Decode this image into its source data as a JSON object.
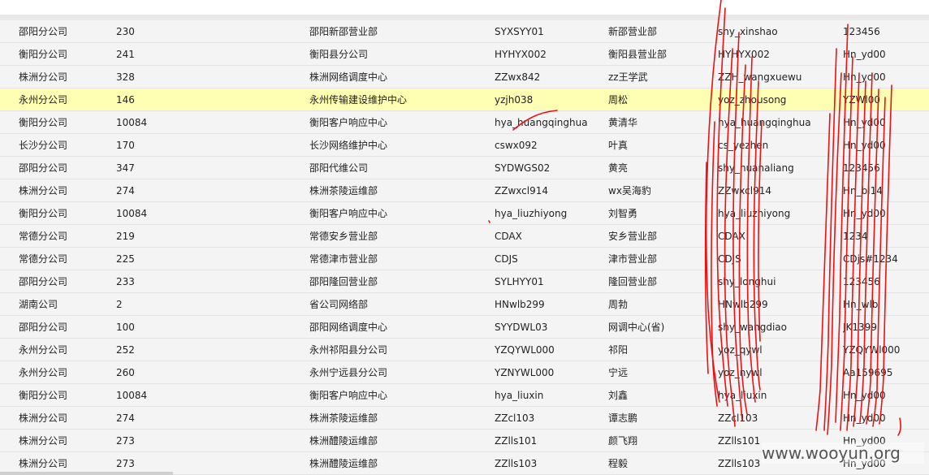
{
  "table": {
    "rows": [
      {
        "branch": "邵阳分公司",
        "code": "230",
        "department": "邵阳新邵营业部",
        "account": "SYXSYY01",
        "name": "新邵营业部",
        "login": "shy_xinshao",
        "password": "123456",
        "highlighted": false
      },
      {
        "branch": "衡阳分公司",
        "code": "241",
        "department": "衡阳县分公司",
        "account": "HYHYX002",
        "name": "衡阳县营业部",
        "login": "HYHYX002",
        "password": "Hn_yd00",
        "highlighted": false
      },
      {
        "branch": "株洲分公司",
        "code": "328",
        "department": "株洲网络调度中心",
        "account": "ZZwx842",
        "name": "zz王学武",
        "login": "ZZH_wangxuewu",
        "password": "Hn_yd00",
        "highlighted": false
      },
      {
        "branch": "永州分公司",
        "code": "146",
        "department": "永州传输建设维护中心",
        "account": "yzjh038",
        "name": "周松",
        "login": "yoz_zhousong",
        "password": "YZWl00",
        "highlighted": true
      },
      {
        "branch": "衡阳分公司",
        "code": "10084",
        "department": "衡阳客户响应中心",
        "account": "hya_huangqinghua",
        "name": "黄清华",
        "login": "hya_huangqinghua",
        "password": "Hn_yd00",
        "highlighted": false
      },
      {
        "branch": "长沙分公司",
        "code": "170",
        "department": "长沙网络维护中心",
        "account": "cswx092",
        "name": "叶真",
        "login": "cs_yezhen",
        "password": "Hn_yd00",
        "highlighted": false
      },
      {
        "branch": "邵阳分公司",
        "code": "347",
        "department": "邵阳代维公司",
        "account": "SYDWGS02",
        "name": "黄亮",
        "login": "shy_huanaliang",
        "password": "123456",
        "highlighted": false
      },
      {
        "branch": "株洲分公司",
        "code": "274",
        "department": "株洲茶陵运维部",
        "account": "ZZwxcl914",
        "name": "wx吴海豹",
        "login": "ZZwxcl914",
        "password": "Hn_bl14",
        "highlighted": false
      },
      {
        "branch": "衡阳分公司",
        "code": "10084",
        "department": "衡阳客户响应中心",
        "account": "hya_liuzhiyong",
        "name": "刘智勇",
        "login": "hya_liuzhiyong",
        "password": "Hn_yd00",
        "highlighted": false
      },
      {
        "branch": "常德分公司",
        "code": "219",
        "department": "常德安乡营业部",
        "account": "CDAX",
        "name": "安乡营业部",
        "login": "CDAX",
        "password": "1234",
        "highlighted": false
      },
      {
        "branch": "常德分公司",
        "code": "225",
        "department": "常德津市营业部",
        "account": "CDJS",
        "name": "津市营业部",
        "login": "CDJS",
        "password": "CDjs#1234",
        "highlighted": false
      },
      {
        "branch": "邵阳分公司",
        "code": "233",
        "department": "邵阳隆回营业部",
        "account": "SYLHYY01",
        "name": "隆回营业部",
        "login": "shy_longhui",
        "password": "123456",
        "highlighted": false
      },
      {
        "branch": "湖南公司",
        "code": "2",
        "department": "省公司网络部",
        "account": "HNwlb299",
        "name": "周勃",
        "login": "HNwlb299",
        "password": "Hn_wlb",
        "highlighted": false
      },
      {
        "branch": "邵阳分公司",
        "code": "100",
        "department": "邵阳网络调度中心",
        "account": "SYYDWL03",
        "name": "网调中心(省)",
        "login": "shy_wangdiao",
        "password": "JK1399",
        "highlighted": false
      },
      {
        "branch": "永州分公司",
        "code": "252",
        "department": "永州祁阳县分公司",
        "account": "YZQYWL000",
        "name": "祁阳",
        "login": "yoz_qywl",
        "password": "YZQYWl000",
        "highlighted": false
      },
      {
        "branch": "永州分公司",
        "code": "260",
        "department": "永州宁远县分公司",
        "account": "YZNYWL000",
        "name": "宁远",
        "login": "yoz_nywl",
        "password": "Aa159695",
        "highlighted": false
      },
      {
        "branch": "衡阳分公司",
        "code": "10084",
        "department": "衡阳客户响应中心",
        "account": "hya_liuxin",
        "name": "刘鑫",
        "login": "hya_liuxin",
        "password": "Hn_yd00",
        "highlighted": false
      },
      {
        "branch": "株洲分公司",
        "code": "274",
        "department": "株洲茶陵运维部",
        "account": "ZZcl103",
        "name": "谭志鹏",
        "login": "ZZcl103",
        "password": "Hn_yd00",
        "highlighted": false
      },
      {
        "branch": "株洲分公司",
        "code": "273",
        "department": "株洲醴陵运维部",
        "account": "ZZlls101",
        "name": "颜飞翔",
        "login": "ZZlls101",
        "password": "Hn_yd00",
        "highlighted": false
      },
      {
        "branch": "株洲分公司",
        "code": "273",
        "department": "株洲醴陵运维部",
        "account": "ZZlls103",
        "name": "程毅",
        "login": "ZZlls103",
        "password": "Hn_yd00",
        "highlighted": false
      }
    ]
  },
  "watermark": "www.wooyun.org",
  "colors": {
    "row_background": "#f4f4f4",
    "highlight_row": "#ffffb3",
    "redaction_ink": "#ee1111"
  }
}
